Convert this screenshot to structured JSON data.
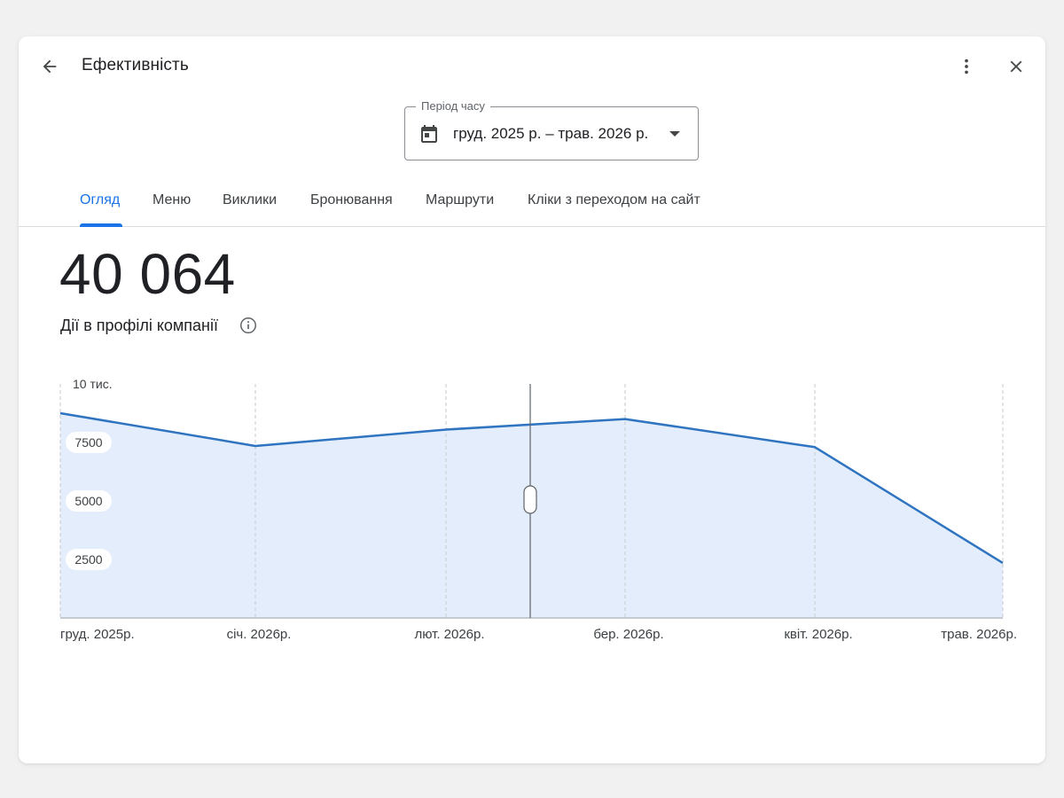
{
  "header": {
    "title": "Ефективність",
    "back_icon": "arrow-back-icon",
    "more_icon": "more-vert-icon",
    "close_icon": "close-icon"
  },
  "period": {
    "label": "Період часу",
    "value": "груд. 2025 р. – трав. 2026 р.",
    "icon": "calendar-icon"
  },
  "tabs": [
    {
      "label": "Огляд",
      "active": true
    },
    {
      "label": "Меню"
    },
    {
      "label": "Виклики"
    },
    {
      "label": "Бронювання"
    },
    {
      "label": "Маршрути"
    },
    {
      "label": "Кліки з переходом на сайт"
    }
  ],
  "summary": {
    "total": "40 064",
    "label": "Дії в профілі компанії"
  },
  "colors": {
    "accent": "#1a73e8",
    "line": "#2f74c0",
    "area": "#e3edfb"
  },
  "chart_data": {
    "type": "area",
    "categories": [
      "груд. 2025р.",
      "січ. 2026р.",
      "лют. 2026р.",
      "бер. 2026р.",
      "квіт. 2026р.",
      "трав. 2026р."
    ],
    "values": [
      8750,
      7350,
      8050,
      8500,
      7300,
      2350
    ],
    "hover_value": 8250,
    "ylim": [
      0,
      10000
    ],
    "y_ticks": [
      {
        "value": 10000,
        "label": "10 тис."
      },
      {
        "value": 7500,
        "label": "7500"
      },
      {
        "value": 5000,
        "label": "5000"
      },
      {
        "value": 2500,
        "label": "2500"
      }
    ],
    "grid": "vertical-dashed",
    "title": "",
    "xlabel": "",
    "ylabel": ""
  }
}
